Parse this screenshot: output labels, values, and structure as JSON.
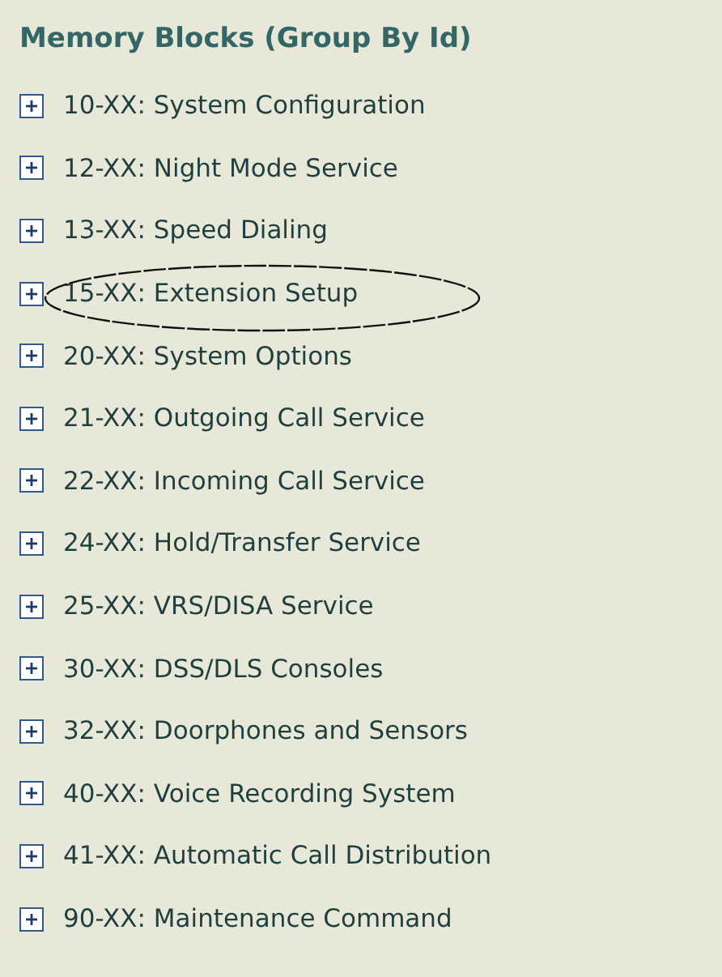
{
  "title": "Memory Blocks (Group By Id)",
  "items": [
    {
      "label": "10-XX: System Configuration",
      "expanded": false,
      "circled": false
    },
    {
      "label": "12-XX: Night Mode Service",
      "expanded": false,
      "circled": false
    },
    {
      "label": "13-XX: Speed Dialing",
      "expanded": false,
      "circled": false
    },
    {
      "label": "15-XX: Extension Setup",
      "expanded": false,
      "circled": true
    },
    {
      "label": "20-XX: System Options",
      "expanded": false,
      "circled": false
    },
    {
      "label": "21-XX: Outgoing Call Service",
      "expanded": false,
      "circled": false
    },
    {
      "label": "22-XX: Incoming Call Service",
      "expanded": false,
      "circled": false
    },
    {
      "label": "24-XX: Hold/Transfer Service",
      "expanded": false,
      "circled": false
    },
    {
      "label": "25-XX: VRS/DISA Service",
      "expanded": false,
      "circled": false
    },
    {
      "label": "30-XX: DSS/DLS Consoles",
      "expanded": false,
      "circled": false
    },
    {
      "label": "32-XX: Doorphones and Sensors",
      "expanded": false,
      "circled": false
    },
    {
      "label": "40-XX: Voice Recording System",
      "expanded": false,
      "circled": false
    },
    {
      "label": "41-XX: Automatic Call Distribution",
      "expanded": false,
      "circled": false
    },
    {
      "label": "90-XX: Maintenance Command",
      "expanded": false,
      "circled": false
    }
  ]
}
